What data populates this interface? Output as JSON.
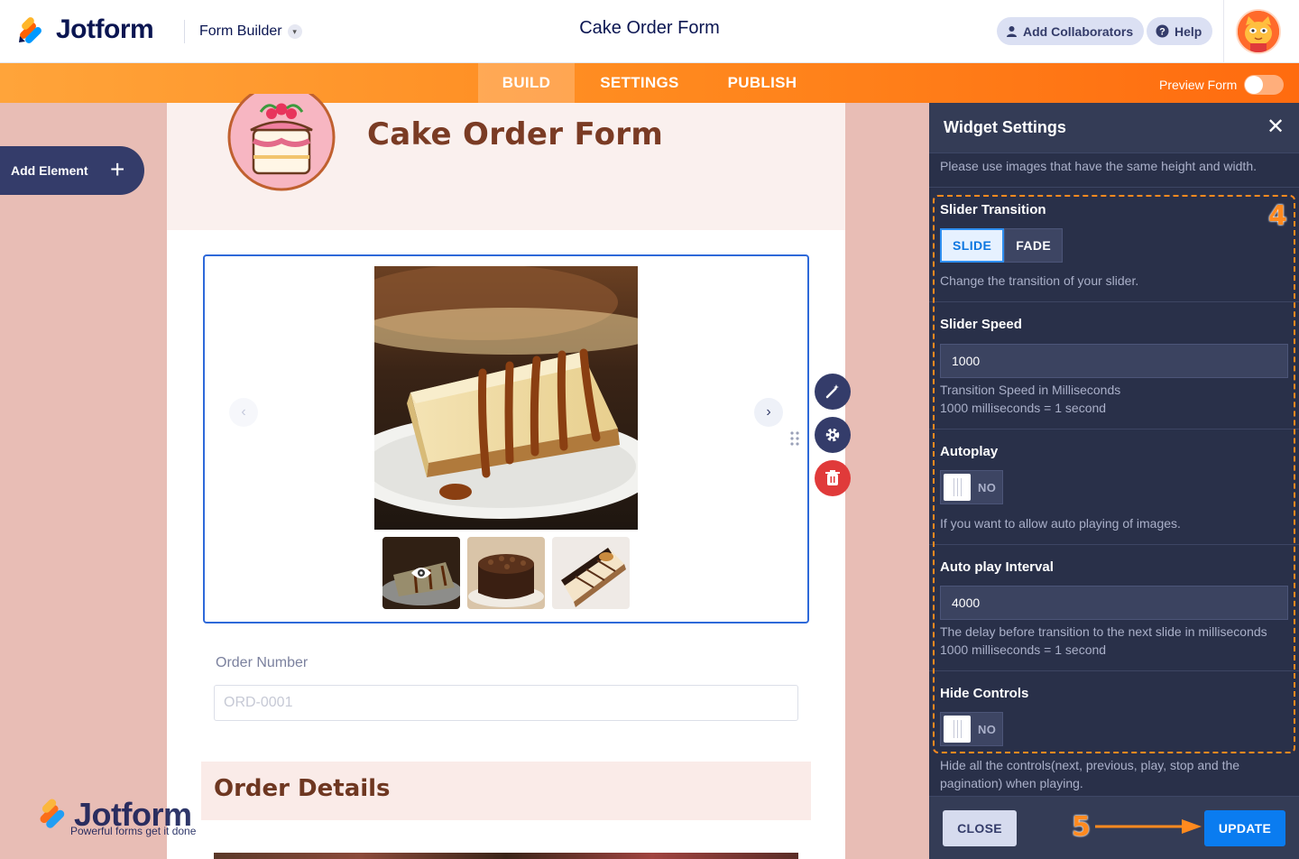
{
  "header": {
    "brand": "Jotform",
    "builder_label": "Form Builder",
    "form_title": "Cake Order Form",
    "add_collaborators": "Add Collaborators",
    "help": "Help"
  },
  "nav": {
    "tabs": [
      "BUILD",
      "SETTINGS",
      "PUBLISH"
    ],
    "active_tab": "BUILD",
    "preview_label": "Preview Form",
    "preview_on": false
  },
  "sidebar": {
    "add_element": "Add Element"
  },
  "form": {
    "title": "Cake Order Form",
    "slider": {
      "thumbnail_count": 3,
      "active_thumbnail": 1
    },
    "order_number_label": "Order Number",
    "order_number_placeholder": "ORD-0001",
    "section_title": "Order Details"
  },
  "watermark": {
    "brand": "Jotform",
    "tagline": "Powerful forms get it done"
  },
  "panel": {
    "title": "Widget Settings",
    "intro_note": "Please use images that have the same height and width.",
    "transition": {
      "label": "Slider Transition",
      "options": [
        "SLIDE",
        "FADE"
      ],
      "selected": "SLIDE",
      "note": "Change the transition of your slider."
    },
    "speed": {
      "label": "Slider Speed",
      "value": "1000",
      "note1": "Transition Speed in Milliseconds",
      "note2": "1000 milliseconds = 1 second"
    },
    "autoplay": {
      "label": "Autoplay",
      "state": "NO",
      "note": "If you want to allow auto playing of images."
    },
    "interval": {
      "label": "Auto play Interval",
      "value": "4000",
      "note1": "The delay before transition to the next slide in milliseconds",
      "note2": "1000 milliseconds = 1 second"
    },
    "hide_controls": {
      "label": "Hide Controls",
      "state": "NO",
      "note1": "Hide all the controls(next, previous, play, stop and the",
      "note2": "pagination) when playing."
    },
    "close_button": "CLOSE",
    "update_button": "UPDATE"
  },
  "annotations": {
    "step4": "4",
    "step5": "5",
    "accent": "#ff8a1f"
  },
  "colors": {
    "primary_blue": "#0a7cf0",
    "panel_bg": "#293049",
    "nav_orange": "#ff8a1f",
    "brand_navy": "#0a1551"
  }
}
